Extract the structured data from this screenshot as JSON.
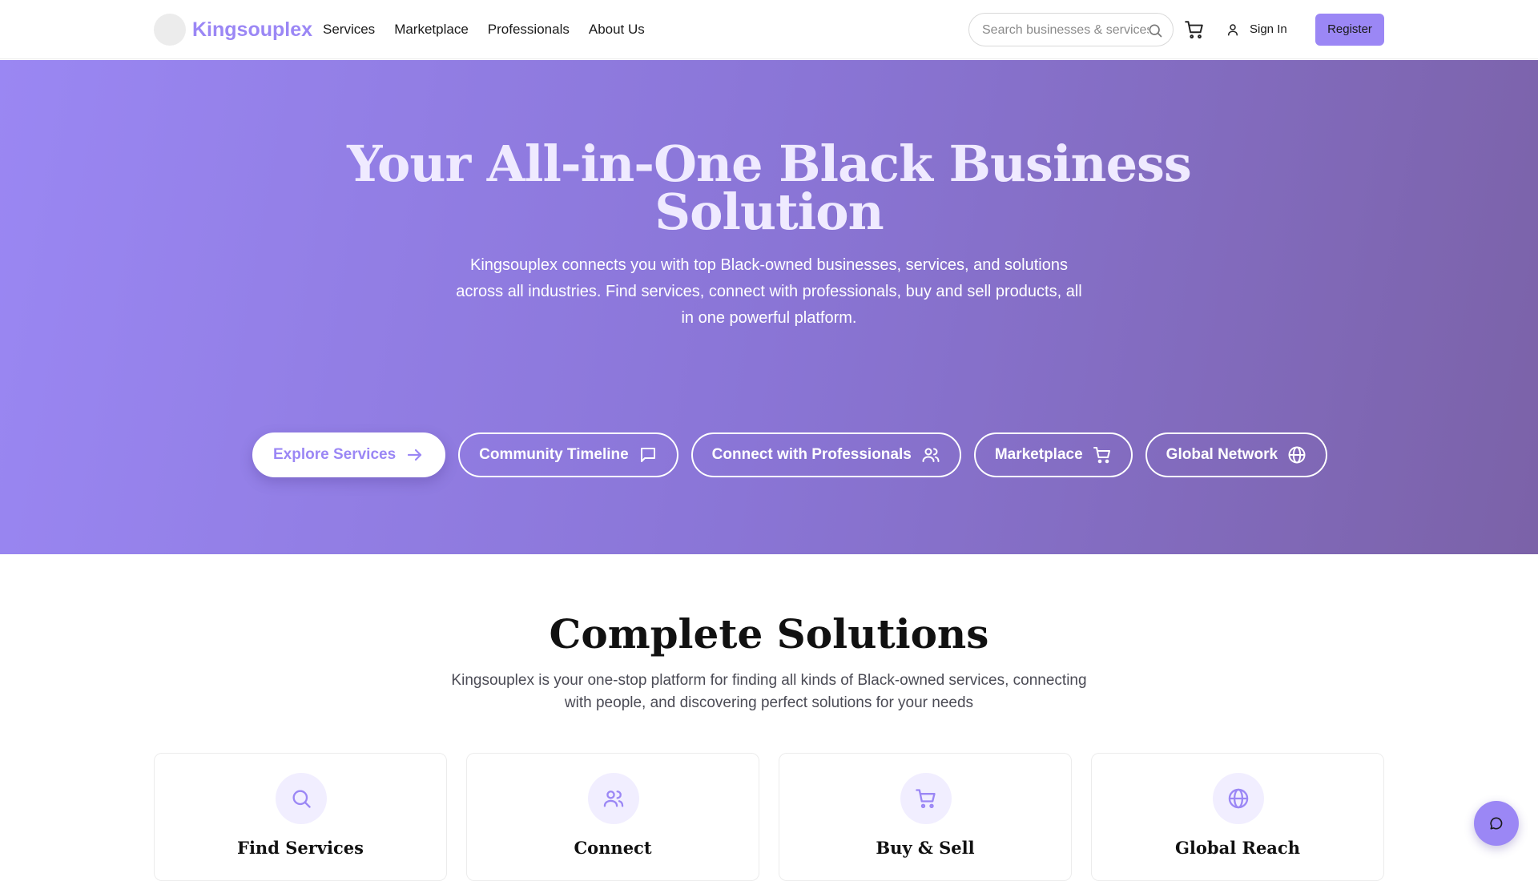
{
  "brand": {
    "name": "Kingsouplex",
    "accent": "#9b87f5"
  },
  "nav": {
    "links": [
      "Services",
      "Marketplace",
      "Professionals",
      "About Us"
    ],
    "search_placeholder": "Search businesses & services...",
    "sign_in": "Sign In",
    "register": "Register"
  },
  "hero": {
    "title": "Your All-in-One Black Business Solution",
    "subtitle": "Kingsouplex connects you with top Black-owned businesses, services, and solutions across all industries. Find services, connect with professionals, buy and sell products, all in one powerful platform.",
    "ctas": [
      {
        "label": "Explore Services",
        "icon": "arrow-right-icon"
      },
      {
        "label": "Community Timeline",
        "icon": "message-square-icon"
      },
      {
        "label": "Connect with Professionals",
        "icon": "users-icon"
      },
      {
        "label": "Marketplace",
        "icon": "cart-icon"
      },
      {
        "label": "Global Network",
        "icon": "globe-icon"
      }
    ],
    "gradient": [
      "#9a87f3",
      "#7b62a8"
    ]
  },
  "solutions": {
    "title": "Complete Solutions",
    "subtitle": "Kingsouplex is your one-stop platform for finding all kinds of Black-owned services, connecting with people, and discovering perfect solutions for your needs",
    "cards": [
      {
        "title": "Find Services",
        "icon": "search-icon"
      },
      {
        "title": "Connect",
        "icon": "users-icon"
      },
      {
        "title": "Buy & Sell",
        "icon": "cart-icon"
      },
      {
        "title": "Global Reach",
        "icon": "globe-icon"
      }
    ]
  },
  "chat": {
    "icon": "chat-bubble-icon"
  }
}
